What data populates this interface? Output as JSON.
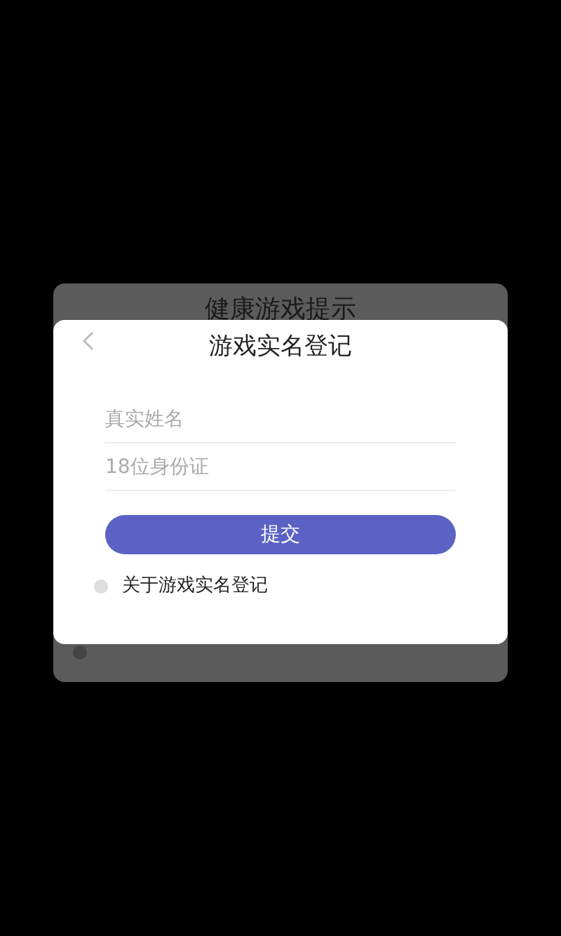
{
  "back_dialog": {
    "title": "健康游戏提示"
  },
  "dialog": {
    "title": "游戏实名登记",
    "fields": [
      {
        "placeholder": "真实姓名"
      },
      {
        "placeholder": "18位身份证"
      }
    ],
    "submit": "提交",
    "info_link": "关于游戏实名登记"
  }
}
